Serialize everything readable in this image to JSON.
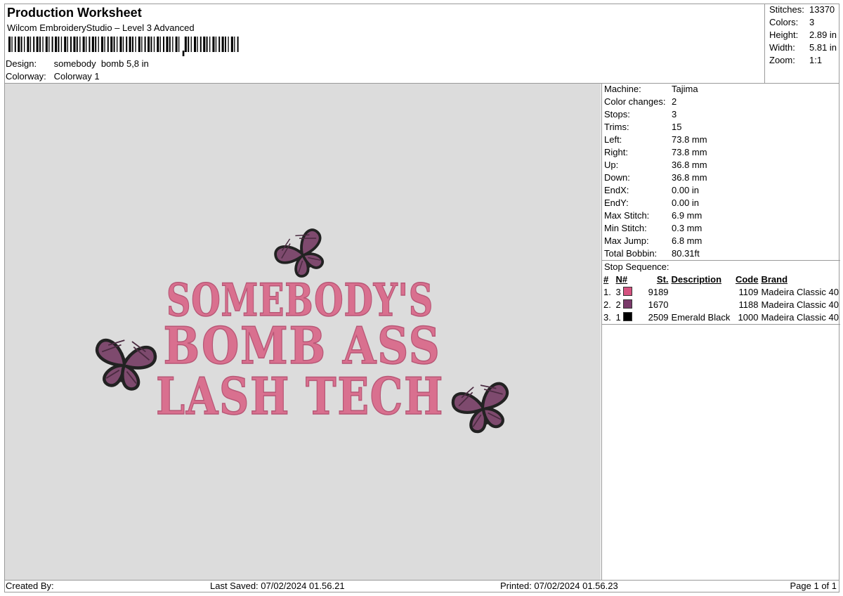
{
  "header": {
    "title": "Production Worksheet",
    "software": "Wilcom EmbroideryStudio – Level 3 Advanced",
    "barcode_text": "||||||||||||||||||||||||||||||||||||||||||||||||||||||||,||||||||||||||||||",
    "design_label": "Design:",
    "design_value": "somebody  bomb 5,8 in",
    "colorway_label": "Colorway:",
    "colorway_value": "Colorway 1"
  },
  "summary": [
    {
      "label": "Stitches:",
      "value": "13370"
    },
    {
      "label": "Colors:",
      "value": "3"
    },
    {
      "label": "Height:",
      "value": "2.89 in"
    },
    {
      "label": "Width:",
      "value": "5.81 in"
    },
    {
      "label": "Zoom:",
      "value": "1:1"
    }
  ],
  "machine_info": [
    {
      "label": "Machine:",
      "value": "Tajima"
    },
    {
      "label": "Color changes:",
      "value": "2"
    },
    {
      "label": "Stops:",
      "value": "3"
    },
    {
      "label": "Trims:",
      "value": "15"
    },
    {
      "label": "Left:",
      "value": "73.8 mm"
    },
    {
      "label": "Right:",
      "value": "73.8 mm"
    },
    {
      "label": "Up:",
      "value": "36.8 mm"
    },
    {
      "label": "Down:",
      "value": "36.8 mm"
    },
    {
      "label": "EndX:",
      "value": "0.00 in"
    },
    {
      "label": "EndY:",
      "value": "0.00 in"
    },
    {
      "label": "Max Stitch:",
      "value": "6.9 mm"
    },
    {
      "label": "Min Stitch:",
      "value": "0.3 mm"
    },
    {
      "label": "Max Jump:",
      "value": "6.8 mm"
    },
    {
      "label": "Total Bobbin:",
      "value": "80.31ft"
    }
  ],
  "stop_sequence": {
    "title": "Stop Sequence:",
    "headers": {
      "num": "#",
      "n": "N#",
      "st": "St.",
      "description": "Description",
      "code": "Code",
      "brand": "Brand"
    },
    "rows": [
      {
        "num": "1.",
        "n": "3",
        "color": "#d4527f",
        "st": "9189",
        "description": "",
        "code": "1109",
        "brand": "Madeira Classic 40"
      },
      {
        "num": "2.",
        "n": "2",
        "color": "#7a3a6a",
        "st": "1670",
        "description": "",
        "code": "1188",
        "brand": "Madeira Classic 40"
      },
      {
        "num": "3.",
        "n": "1",
        "color": "#000000",
        "st": "2509",
        "description": "Emerald Black",
        "code": "1000",
        "brand": "Madeira Classic 40"
      }
    ]
  },
  "design_preview": {
    "lines": [
      "SOMEBODY'S",
      "BOMB ASS",
      "LASH TECH"
    ],
    "text_color": "#d9708f",
    "wing_color": "#7e4a6e",
    "outline_color": "#222222"
  },
  "footer": {
    "created_by": "Created By:",
    "last_saved": "Last Saved: 07/02/2024 01.56.21",
    "printed": "Printed: 07/02/2024 01.56.23",
    "page": "Page 1 of 1"
  }
}
